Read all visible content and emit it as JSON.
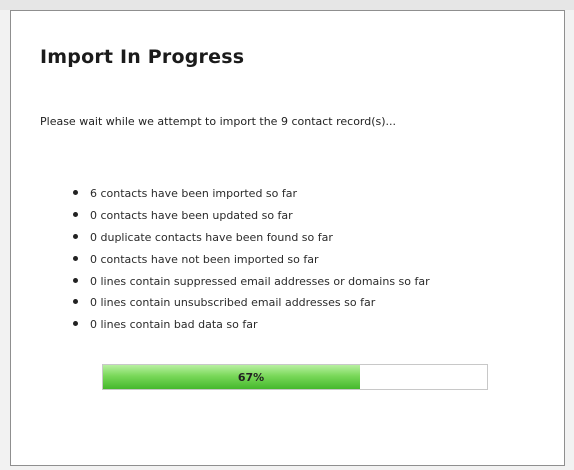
{
  "dialog": {
    "title": "Import In Progress",
    "intro_text": "Please wait while we attempt to import the 9 contact record(s)..."
  },
  "status_items": [
    "6 contacts have been imported so far",
    "0 contacts have been updated so far",
    "0 duplicate contacts have been found so far",
    "0 contacts have not been imported so far",
    "0 lines contain suppressed email addresses or domains so far",
    "0 lines contain unsubscribed email addresses so far",
    "0 lines contain bad data so far"
  ],
  "progress": {
    "label": "67%",
    "fraction": 0.67
  }
}
